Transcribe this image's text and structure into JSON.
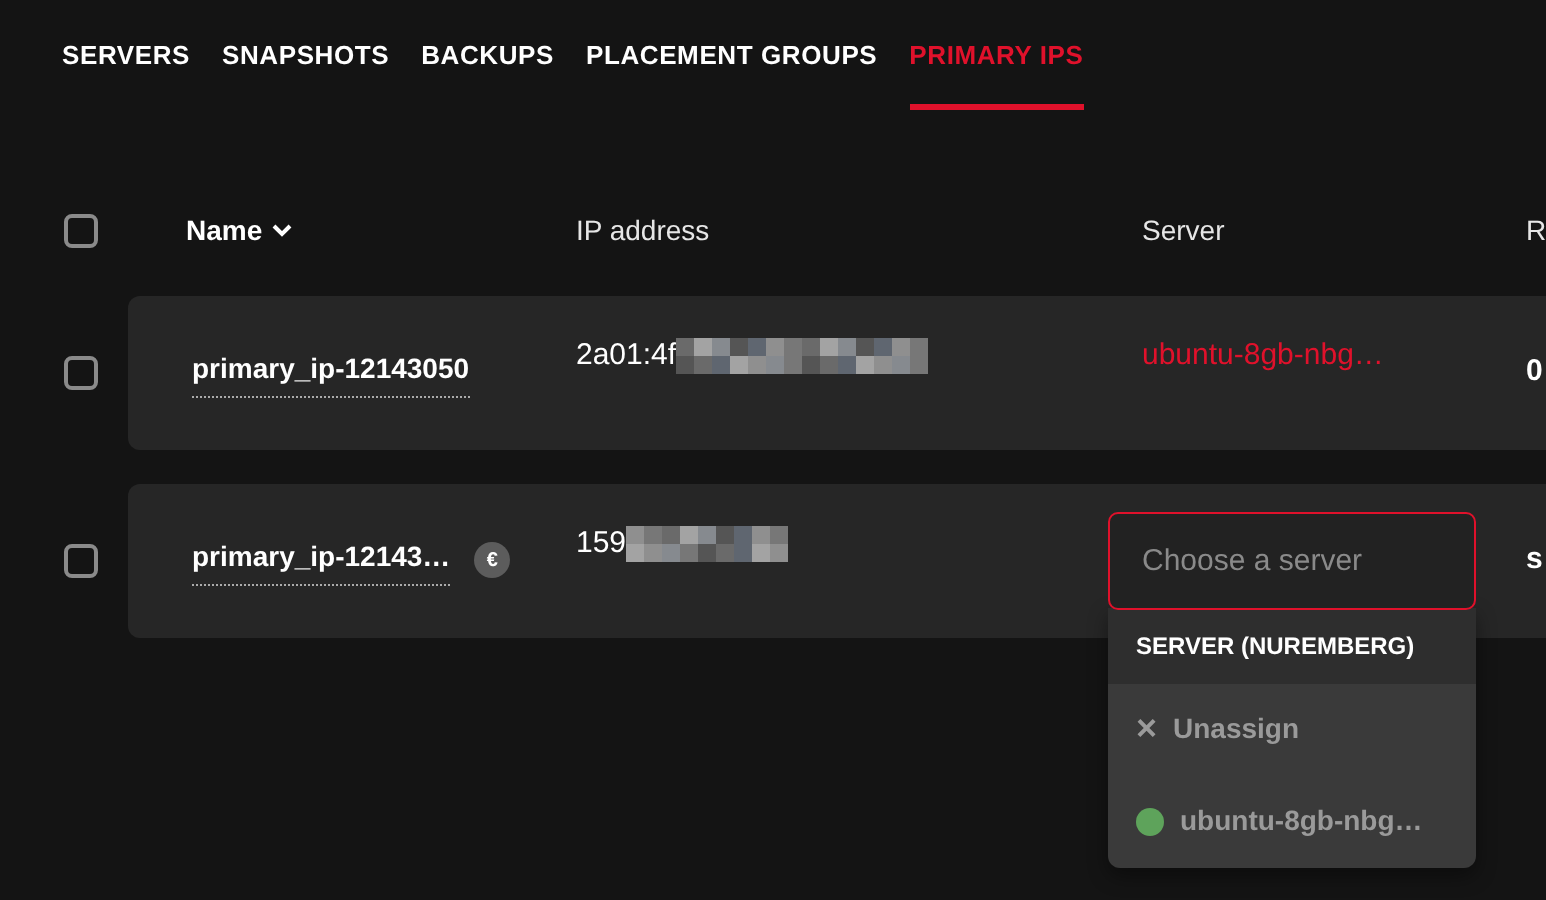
{
  "tabs": [
    {
      "label": "SERVERS",
      "selected": false
    },
    {
      "label": "SNAPSHOTS",
      "selected": false
    },
    {
      "label": "BACKUPS",
      "selected": false
    },
    {
      "label": "PLACEMENT GROUPS",
      "selected": false
    },
    {
      "label": "PRIMARY IPS",
      "selected": true
    }
  ],
  "table": {
    "select_all_checked": false,
    "columns": [
      {
        "label": "Name",
        "sorted": true
      },
      {
        "label": "IP address",
        "sorted": false
      },
      {
        "label": "Server",
        "sorted": false
      },
      {
        "label": "R",
        "sorted": false
      }
    ],
    "rows": [
      {
        "checked": false,
        "name": "primary_ip-12143050",
        "billing_badge": "",
        "ip": "2a01:4f",
        "server": "ubuntu-8gb-nbg…",
        "column_4": "0"
      },
      {
        "checked": false,
        "name": "primary_ip-12143…",
        "billing_badge": "€",
        "ip": "159",
        "server_field": {
          "placeholder": "Choose a server"
        },
        "column_4": "s"
      }
    ]
  },
  "dropdown": {
    "group": "SERVER (NUREMBERG)",
    "options": [
      {
        "kind": "unassign",
        "icon": "×",
        "label": "Unassign"
      },
      {
        "kind": "server",
        "label": "ubuntu-8gb-nbg…",
        "color": "#5ea35b"
      }
    ]
  }
}
